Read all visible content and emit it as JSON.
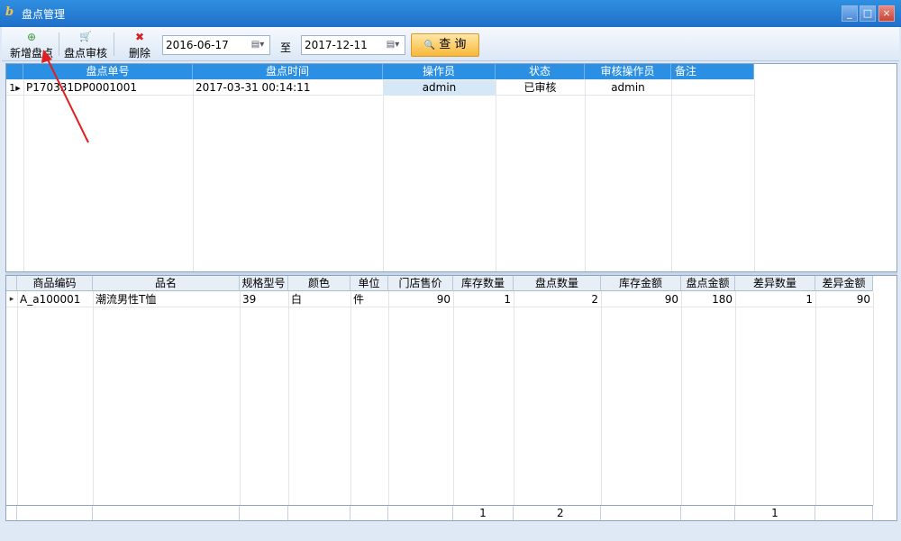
{
  "window": {
    "title": "盘点管理",
    "app_icon_glyph": "b",
    "minimize": "_",
    "maximize": "□",
    "close": "×"
  },
  "toolbar": {
    "add_icon": "⊕",
    "add_label": "新增盘点",
    "review_icon": "🛒",
    "review_label": "盘点审核",
    "delete_icon": "✖",
    "delete_label": "删除",
    "date_from": "2016-06-17",
    "to_label": "至",
    "date_to": "2017-12-11",
    "dropdown_glyph": "▤▾",
    "query_label": "查 询",
    "query_icon": "🔍"
  },
  "top_grid": {
    "columns": [
      "盘点单号",
      "盘点时间",
      "操作员",
      "状态",
      "审核操作员",
      "备注"
    ],
    "rows": [
      {
        "indicator": "1▸",
        "order_no": "P170331DP0001001",
        "time": "2017-03-31 00:14:11",
        "operator": "admin",
        "status": "已审核",
        "reviewer": "admin",
        "remark": ""
      }
    ]
  },
  "bottom_grid": {
    "columns": [
      "商品编码",
      "品名",
      "规格型号",
      "颜色",
      "单位",
      "门店售价",
      "库存数量",
      "盘点数量",
      "库存金额",
      "盘点金额",
      "差异数量",
      "差异金额"
    ],
    "rows": [
      {
        "indicator": "▸",
        "code": "A_a100001",
        "name": "潮流男性T恤",
        "spec": "39",
        "color": "白",
        "unit": "件",
        "price": "90",
        "stock_qty": "1",
        "count_qty": "2",
        "stock_amount": "90",
        "count_amount": "180",
        "diff_qty": "1",
        "diff_amount": "90"
      }
    ],
    "totals": {
      "stock_qty": "1",
      "count_qty": "2",
      "diff_qty": "1"
    }
  },
  "colors": {
    "title_bar": "#1f6fc8",
    "grid_header": "#2b8fe3",
    "annotation_arrow": "#e02020"
  }
}
